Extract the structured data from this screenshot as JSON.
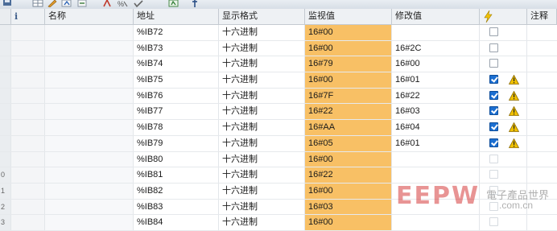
{
  "table": {
    "columns": {
      "info": "i",
      "name": "名称",
      "address": "地址",
      "display_format": "显示格式",
      "monitor_value": "监视值",
      "modify_value": "修改值",
      "comment": "注释"
    },
    "rows": [
      {
        "idx": "",
        "address": "%IB72",
        "format": "十六进制",
        "monitor": "16#00",
        "modify": "",
        "checked": false,
        "warn": false,
        "cb_disabled": false
      },
      {
        "idx": "",
        "address": "%IB73",
        "format": "十六进制",
        "monitor": "16#00",
        "modify": "16#2C",
        "checked": false,
        "warn": false,
        "cb_disabled": false
      },
      {
        "idx": "",
        "address": "%IB74",
        "format": "十六进制",
        "monitor": "16#79",
        "modify": "16#00",
        "checked": false,
        "warn": false,
        "cb_disabled": false
      },
      {
        "idx": "",
        "address": "%IB75",
        "format": "十六进制",
        "monitor": "16#00",
        "modify": "16#01",
        "checked": true,
        "warn": true,
        "cb_disabled": false
      },
      {
        "idx": "",
        "address": "%IB76",
        "format": "十六进制",
        "monitor": "16#7F",
        "modify": "16#22",
        "checked": true,
        "warn": true,
        "cb_disabled": false
      },
      {
        "idx": "",
        "address": "%IB77",
        "format": "十六进制",
        "monitor": "16#22",
        "modify": "16#03",
        "checked": true,
        "warn": true,
        "cb_disabled": false
      },
      {
        "idx": "",
        "address": "%IB78",
        "format": "十六进制",
        "monitor": "16#AA",
        "modify": "16#04",
        "checked": true,
        "warn": true,
        "cb_disabled": false
      },
      {
        "idx": "",
        "address": "%IB79",
        "format": "十六进制",
        "monitor": "16#05",
        "modify": "16#01",
        "checked": true,
        "warn": true,
        "cb_disabled": false
      },
      {
        "idx": "",
        "address": "%IB80",
        "format": "十六进制",
        "monitor": "16#00",
        "modify": "",
        "checked": false,
        "warn": false,
        "cb_disabled": true
      },
      {
        "idx": "0",
        "address": "%IB81",
        "format": "十六进制",
        "monitor": "16#22",
        "modify": "",
        "checked": false,
        "warn": false,
        "cb_disabled": true
      },
      {
        "idx": "1",
        "address": "%IB82",
        "format": "十六进制",
        "monitor": "16#00",
        "modify": "",
        "checked": false,
        "warn": false,
        "cb_disabled": true
      },
      {
        "idx": "2",
        "address": "%IB83",
        "format": "十六进制",
        "monitor": "16#03",
        "modify": "",
        "checked": false,
        "warn": false,
        "cb_disabled": true
      },
      {
        "idx": "3",
        "address": "%IB84",
        "format": "十六进制",
        "monitor": "16#00",
        "modify": "",
        "checked": false,
        "warn": false,
        "cb_disabled": true
      }
    ]
  },
  "icons": {
    "header_flag": "lightning-icon",
    "warning": "warning-triangle-icon",
    "toolbar": [
      "save-icon",
      "grid-icon",
      "edit-icon",
      "refresh-icon",
      "link-icon",
      "modify-icon",
      "export-icon",
      "pin-icon"
    ]
  },
  "colors": {
    "monitor_fill": "#f8c065",
    "checkbox_on": "#1c6fd1",
    "warning": "#f2c200"
  },
  "watermark": {
    "logo": "EEPW",
    "chinese": "電子產品世界",
    "url": ".com.cn"
  }
}
